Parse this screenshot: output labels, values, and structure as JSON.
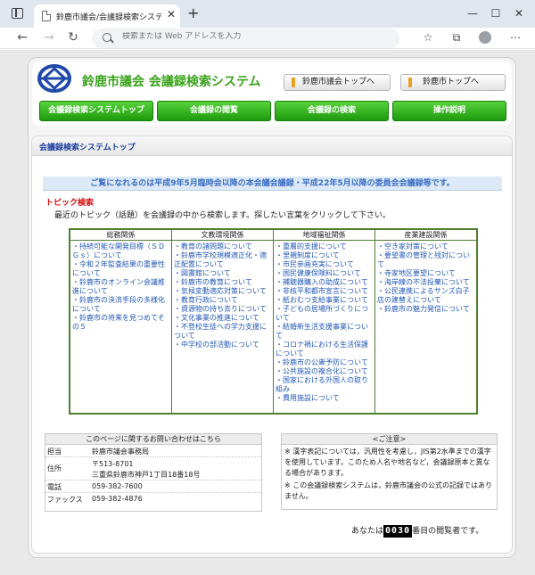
{
  "browser": {
    "tab_title": "鈴鹿市議会/会議録検索システム",
    "tab_close": "✕",
    "new_tab": "+",
    "address_placeholder": "検索または Web アドレスを入力",
    "window_controls": [
      "—",
      "☐",
      "✕"
    ]
  },
  "header": {
    "site_title": "鈴鹿市議会 会議録検索システム",
    "top_links": [
      "鈴鹿市議会トップへ",
      "鈴鹿市トップへ"
    ],
    "menu": [
      "会議録検索システムトップ",
      "会議録の閲覧",
      "会議録の検索",
      "操作説明"
    ]
  },
  "content": {
    "title": "会議録検索システムトップ",
    "notice": "ご覧になれるのは平成9年5月臨時会以降の本会議会議録・平成22年5月以降の委員会会議録等です。",
    "topic_heading": "トピック検索",
    "topic_desc": "最近のトピック（話題）を会議録の中から検索します。探したい言葉をクリックして下さい。",
    "topics": [
      {
        "heading": "総務関係",
        "items": [
          "持続可能な開発目標（ＳＤＧｓ）について",
          "令和２年監査結果の重要性について",
          "鈴鹿市のオンライン会議推進について",
          "鈴鹿市の決済手段の多様化について",
          "鈴鹿市の将来を見つめてその５"
        ]
      },
      {
        "heading": "文教環境関係",
        "items": [
          "教育の諸問題について",
          "鈴鹿市学校規模適正化・適正配置について",
          "図書館について",
          "鈴鹿市の教育について",
          "気候変動適応対策について",
          "教育行政について",
          "資源物の持ち去りについて",
          "文化事業の推進について",
          "不登校生徒への学力支援について",
          "中学校の部活動について"
        ]
      },
      {
        "heading": "地域福祉関係",
        "items": [
          "重層的支援について",
          "里親制度について",
          "市民参画充実について",
          "国民健康保険料について",
          "補聴器購入の助成について",
          "非核平和都市宣言について",
          "紙おむつ支給事業について",
          "子どもの居場所づくりについて",
          "結婚新生活支援事業について",
          "コロナ禍における生活保護について",
          "鈴鹿市の公衆予防について",
          "公共施設の複合化について",
          "国家における外国人の取り組み",
          "費用施設について"
        ]
      },
      {
        "heading": "産業建設関係",
        "items": [
          "空き家対策について",
          "要望書の管理と残対について",
          "寺家地区要望について",
          "海岸線の不法投棄について",
          "公民連携によるサンズ白子店の建替えについて",
          "鈴鹿市の魅力発信について"
        ]
      }
    ],
    "contact": {
      "heading": "このページに関するお問い合わせはこちら",
      "rows": [
        {
          "label": "担当",
          "value": "鈴鹿市議会事務局"
        },
        {
          "label": "住所",
          "value": "〒513-8701"
        },
        {
          "label": "",
          "value": "三重県鈴鹿市神戸1丁目18番18号"
        },
        {
          "label": "電話",
          "value": "059-382-7600"
        },
        {
          "label": "ファックス",
          "value": "059-382-4876"
        }
      ]
    },
    "caution": {
      "heading": "<ご注意>",
      "paragraphs": [
        "※ 漢字表記については，汎用性を考慮し，JIS第2水準までの漢字を使用しています。このため人名や地名など，会議録原本と異なる場合があります。",
        "※ この会議録検索システムは，鈴鹿市議会の公式の記録ではありません。"
      ]
    },
    "counter": {
      "prefix": "あなたは",
      "number": "0030",
      "suffix": "番目の閲覧者です。"
    }
  }
}
